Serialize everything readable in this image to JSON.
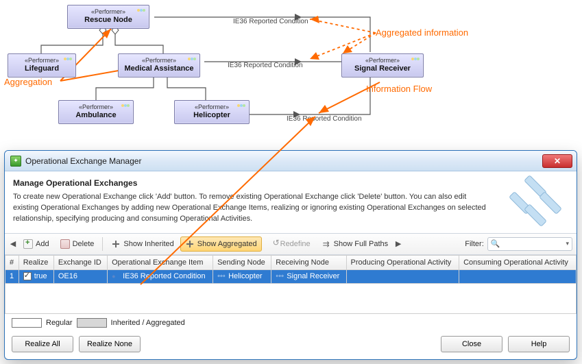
{
  "diagram": {
    "nodes": {
      "rescue": {
        "stereo": "«Performer»",
        "title": "Rescue Node"
      },
      "lifeguard": {
        "stereo": "«Performer»",
        "title": "Lifeguard"
      },
      "medasst": {
        "stereo": "«Performer»",
        "title": "Medical Assistance"
      },
      "signal": {
        "stereo": "«Performer»",
        "title": "Signal Receiver"
      },
      "ambulance": {
        "stereo": "«Performer»",
        "title": "Ambulance"
      },
      "helicopter": {
        "stereo": "«Performer»",
        "title": "Helicopter"
      }
    },
    "edge_labels": {
      "rc1": "IE36 Reported Condition",
      "rc2": "IE36 Reported Condition",
      "rc3": "IE36 Reported Condition"
    },
    "annotations": {
      "agg_info": "Aggregated information",
      "aggregation": "Aggregation",
      "info_flow": "Information Flow"
    }
  },
  "dialog": {
    "title": "Operational Exchange Manager",
    "heading": "Manage Operational Exchanges",
    "description": "To create new Operational Exchange click 'Add' button. To remove existing Operational Exchange click 'Delete' button. You can also edit existing Operational Exchanges by adding new Operational Exchange Items, realizing or ignoring existing Operational Exchanges on selected relationship, specifying producing and consuming Operational Activities.",
    "toolbar": {
      "add": "Add",
      "delete": "Delete",
      "show_inherited": "Show Inherited",
      "show_aggregated": "Show Aggregated",
      "redefine": "Redefine",
      "show_full_paths": "Show Full Paths",
      "filter_label": "Filter:"
    },
    "columns": {
      "num": "#",
      "realize": "Realize",
      "exchange_id": "Exchange ID",
      "item": "Operational Exchange Item",
      "sending": "Sending Node",
      "receiving": "Receiving Node",
      "producing": "Producing Operational Activity",
      "consuming": "Consuming Operational Activity"
    },
    "rows": [
      {
        "num": "1",
        "realize_checked": true,
        "realize_text": "true",
        "exchange_id": "OE16",
        "item": "IE36 Reported Condition",
        "sending": "Helicopter",
        "receiving": "Signal Receiver",
        "producing": "",
        "consuming": ""
      }
    ],
    "legend": {
      "regular": "Regular",
      "inherited": "Inherited / Aggregated"
    },
    "buttons": {
      "realize_all": "Realize All",
      "realize_none": "Realize None",
      "close": "Close",
      "help": "Help"
    }
  }
}
